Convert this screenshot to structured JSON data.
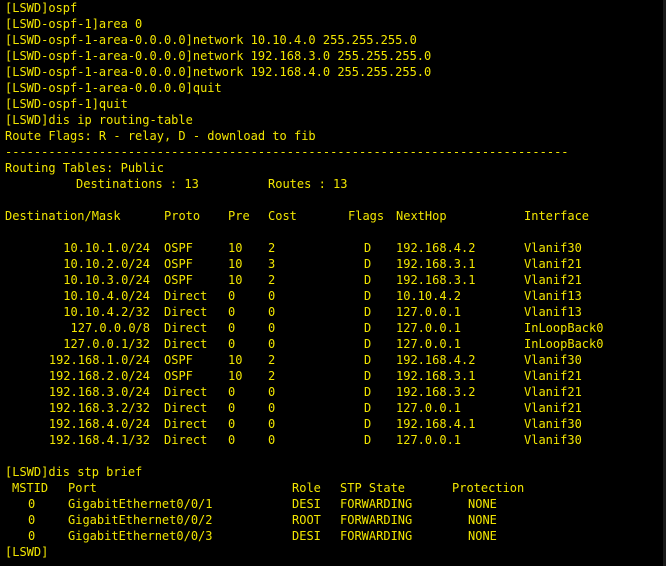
{
  "colors": {
    "background": "#000000",
    "text": "#f2e600"
  },
  "commands": [
    "[LSWD]ospf",
    "[LSWD-ospf-1]area 0",
    "[LSWD-ospf-1-area-0.0.0.0]network 10.10.4.0 255.255.255.0",
    "[LSWD-ospf-1-area-0.0.0.0]network 192.168.3.0 255.255.255.0",
    "[LSWD-ospf-1-area-0.0.0.0]network 192.168.4.0 255.255.255.0",
    "[LSWD-ospf-1-area-0.0.0.0]quit",
    "[LSWD-ospf-1]quit",
    "[LSWD]dis ip routing-table",
    "Route Flags: R - relay, D - download to fib",
    "------------------------------------------------------------------------------",
    "Routing Tables: Public"
  ],
  "routing_info": {
    "destinations": "Destinations : 13",
    "routes": "Routes : 13"
  },
  "routing_table": {
    "headers": {
      "dest": "Destination/Mask",
      "proto": "Proto",
      "pre": "Pre",
      "cost": "Cost",
      "flags": "Flags",
      "nexthop": "NextHop",
      "iface": "Interface"
    },
    "rows": [
      {
        "dest": "10.10.1.0/24",
        "proto": "OSPF",
        "pre": "10",
        "cost": "2",
        "flags": "D",
        "nexthop": "192.168.4.2",
        "iface": "Vlanif30"
      },
      {
        "dest": "10.10.2.0/24",
        "proto": "OSPF",
        "pre": "10",
        "cost": "3",
        "flags": "D",
        "nexthop": "192.168.3.1",
        "iface": "Vlanif21"
      },
      {
        "dest": "10.10.3.0/24",
        "proto": "OSPF",
        "pre": "10",
        "cost": "2",
        "flags": "D",
        "nexthop": "192.168.3.1",
        "iface": "Vlanif21"
      },
      {
        "dest": "10.10.4.0/24",
        "proto": "Direct",
        "pre": "0",
        "cost": "0",
        "flags": "D",
        "nexthop": "10.10.4.2",
        "iface": "Vlanif13"
      },
      {
        "dest": "10.10.4.2/32",
        "proto": "Direct",
        "pre": "0",
        "cost": "0",
        "flags": "D",
        "nexthop": "127.0.0.1",
        "iface": "Vlanif13"
      },
      {
        "dest": "127.0.0.0/8",
        "proto": "Direct",
        "pre": "0",
        "cost": "0",
        "flags": "D",
        "nexthop": "127.0.0.1",
        "iface": "InLoopBack0"
      },
      {
        "dest": "127.0.0.1/32",
        "proto": "Direct",
        "pre": "0",
        "cost": "0",
        "flags": "D",
        "nexthop": "127.0.0.1",
        "iface": "InLoopBack0"
      },
      {
        "dest": "192.168.1.0/24",
        "proto": "OSPF",
        "pre": "10",
        "cost": "2",
        "flags": "D",
        "nexthop": "192.168.4.2",
        "iface": "Vlanif30"
      },
      {
        "dest": "192.168.2.0/24",
        "proto": "OSPF",
        "pre": "10",
        "cost": "2",
        "flags": "D",
        "nexthop": "192.168.3.1",
        "iface": "Vlanif21"
      },
      {
        "dest": "192.168.3.0/24",
        "proto": "Direct",
        "pre": "0",
        "cost": "0",
        "flags": "D",
        "nexthop": "192.168.3.2",
        "iface": "Vlanif21"
      },
      {
        "dest": "192.168.3.2/32",
        "proto": "Direct",
        "pre": "0",
        "cost": "0",
        "flags": "D",
        "nexthop": "127.0.0.1",
        "iface": "Vlanif21"
      },
      {
        "dest": "192.168.4.0/24",
        "proto": "Direct",
        "pre": "0",
        "cost": "0",
        "flags": "D",
        "nexthop": "192.168.4.1",
        "iface": "Vlanif30"
      },
      {
        "dest": "192.168.4.1/32",
        "proto": "Direct",
        "pre": "0",
        "cost": "0",
        "flags": "D",
        "nexthop": "127.0.0.1",
        "iface": "Vlanif30"
      }
    ]
  },
  "stp": {
    "command": "[LSWD]dis stp brief",
    "headers": {
      "mstid": "MSTID",
      "port": "Port",
      "role": "Role",
      "state": "STP State",
      "protection": "Protection"
    },
    "rows": [
      {
        "mstid": "0",
        "port": "GigabitEthernet0/0/1",
        "role": "DESI",
        "state": "FORWARDING",
        "protection": "NONE"
      },
      {
        "mstid": "0",
        "port": "GigabitEthernet0/0/2",
        "role": "ROOT",
        "state": "FORWARDING",
        "protection": "NONE"
      },
      {
        "mstid": "0",
        "port": "GigabitEthernet0/0/3",
        "role": "DESI",
        "state": "FORWARDING",
        "protection": "NONE"
      }
    ]
  },
  "prompt": "[LSWD]"
}
